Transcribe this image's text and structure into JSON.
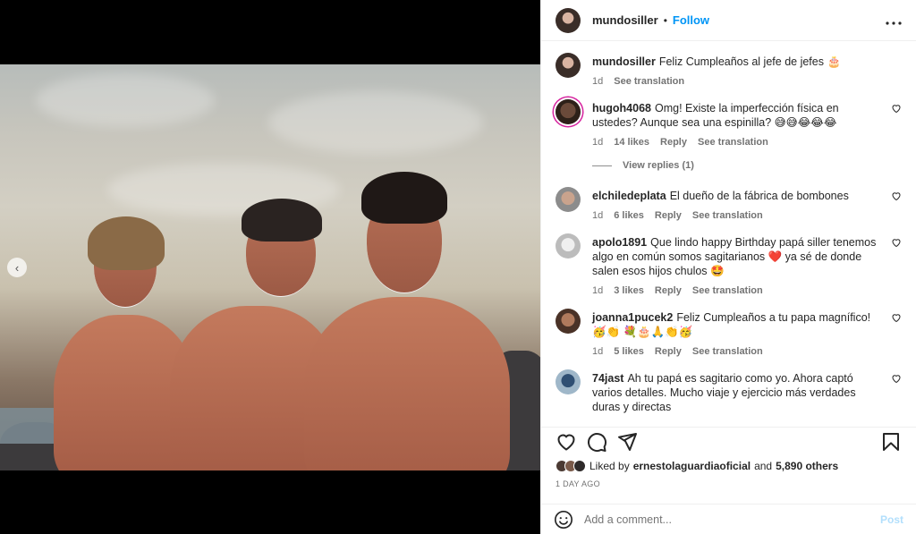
{
  "post": {
    "username": "mundosiller",
    "follow_label": "Follow",
    "dot": "•",
    "more_label": "•••"
  },
  "caption": {
    "username": "mundosiller",
    "text": "Feliz Cumpleaños al jefe de jefes 🎂",
    "time": "1d",
    "see_translation": "See translation"
  },
  "comments": [
    {
      "username": "hugoh4068",
      "text": "Omg! Existe la imperfección física en ustedes? Aunque sea una espinilla? 😅😅😂😂😂",
      "time": "1d",
      "likes": "14 likes",
      "reply": "Reply",
      "see_translation": "See translation",
      "view_replies": "View replies (1)"
    },
    {
      "username": "elchiledeplata",
      "text": "El dueño de la fábrica de bombones",
      "time": "1d",
      "likes": "6 likes",
      "reply": "Reply",
      "see_translation": "See translation"
    },
    {
      "username": "apolo1891",
      "text": "Que lindo happy Birthday papá siller tenemos algo en común somos sagitarianos ❤️ ya sé de donde salen esos hijos chulos 🤩",
      "time": "1d",
      "likes": "3 likes",
      "reply": "Reply",
      "see_translation": "See translation"
    },
    {
      "username": "joanna1pucek2",
      "text": "Feliz Cumpleaños a tu papa magnífico!🥳👏 💐🎂🙏👏🥳",
      "time": "1d",
      "likes": "5 likes",
      "reply": "Reply",
      "see_translation": "See translation"
    },
    {
      "username": "74jast",
      "text": "Ah tu papá es sagitario como yo. Ahora captó varios detalles. Mucho viaje y ejercicio más verdades duras y directas"
    }
  ],
  "likes": {
    "prefix": "Liked by",
    "user": "ernestolaguardiaoficial",
    "and": "and",
    "others": "5,890 others"
  },
  "date": "1 DAY AGO",
  "add_comment": {
    "placeholder": "Add a comment...",
    "post_label": "Post"
  },
  "carousel": {
    "count": 2,
    "active_index": 1
  },
  "colors": {
    "accent": "#0095f6",
    "text": "#262626",
    "muted": "#737373"
  },
  "icons": [
    "heart-icon",
    "comment-icon",
    "share-icon",
    "bookmark-icon",
    "emoji-icon",
    "chevron-left-icon"
  ]
}
